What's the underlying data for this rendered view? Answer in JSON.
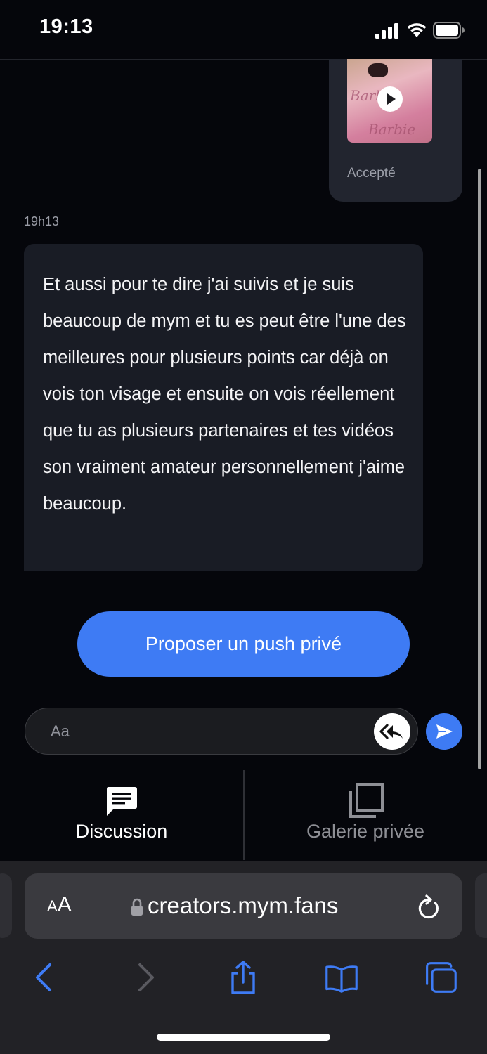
{
  "status_bar": {
    "time": "19:13"
  },
  "chat": {
    "media_message": {
      "status": "Accepté",
      "thumbnail_text": [
        "Barbi",
        "Barbie"
      ]
    },
    "message_time": "19h13",
    "message_text": "Et aussi pour te dire j'ai suivis et je suis beaucoup de mym et tu es peut être l'une des meilleures pour plusieurs points car déjà on vois ton visage et ensuite on vois réellement que tu as plusieurs partenaires et tes vidéos son vraiment amateur personnellement j'aime beaucoup."
  },
  "actions": {
    "push_label": "Proposer un push privé"
  },
  "composer": {
    "placeholder": "Aa"
  },
  "tabs": [
    {
      "label": "Discussion",
      "icon": "chat-icon",
      "active": true
    },
    {
      "label": "Galerie privée",
      "icon": "gallery-icon",
      "active": false
    }
  ],
  "browser": {
    "reader_label_small": "A",
    "reader_label_large": "A",
    "url": "creators.mym.fans"
  },
  "colors": {
    "accent": "#3e7bf4",
    "background": "#05060b",
    "bubble": "#191c25",
    "muted_text": "#9a9ca6"
  }
}
